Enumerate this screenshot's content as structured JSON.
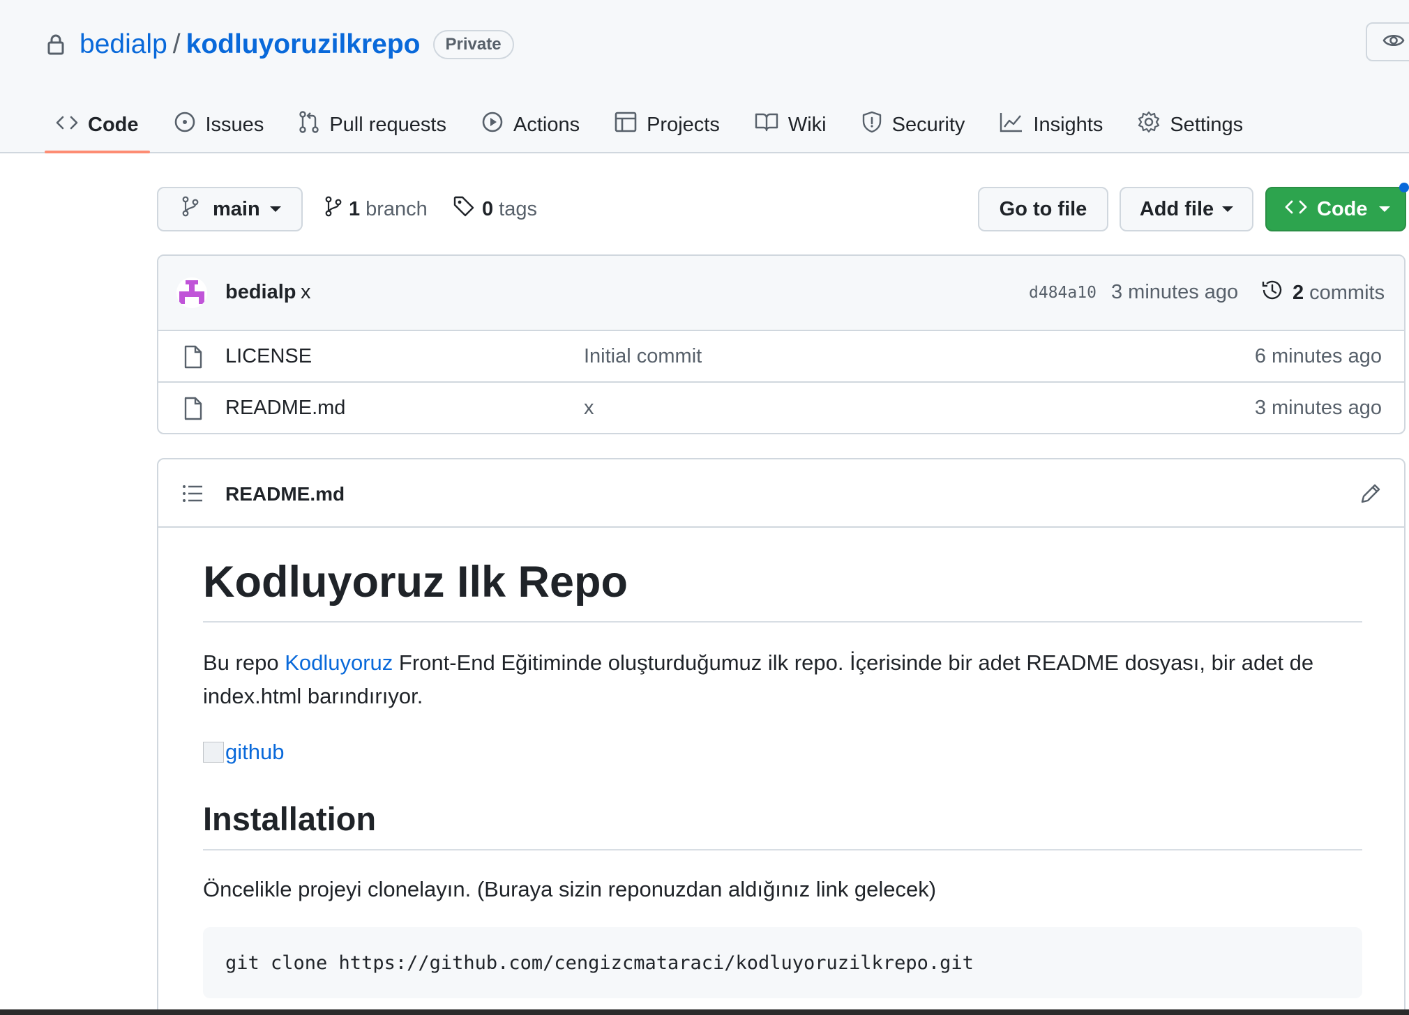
{
  "repo": {
    "owner": "bedialp",
    "separator": "/",
    "name": "kodluyoruzilkrepo",
    "visibility": "Private"
  },
  "tabs": [
    {
      "label": "Code",
      "icon": "code-icon",
      "selected": true
    },
    {
      "label": "Issues",
      "icon": "issue-icon"
    },
    {
      "label": "Pull requests",
      "icon": "pull-request-icon"
    },
    {
      "label": "Actions",
      "icon": "play-icon"
    },
    {
      "label": "Projects",
      "icon": "table-icon"
    },
    {
      "label": "Wiki",
      "icon": "book-icon"
    },
    {
      "label": "Security",
      "icon": "shield-icon"
    },
    {
      "label": "Insights",
      "icon": "graph-icon"
    },
    {
      "label": "Settings",
      "icon": "gear-icon"
    }
  ],
  "toolbar": {
    "branch": "main",
    "branch_count": "1",
    "branch_label": "branch",
    "tag_count": "0",
    "tag_label": "tags",
    "go_to_file": "Go to file",
    "add_file": "Add file",
    "code": "Code"
  },
  "latest_commit": {
    "author": "bedialp",
    "message": "x",
    "sha": "d484a10",
    "time": "3 minutes ago",
    "commit_count": "2",
    "commit_label": "commits"
  },
  "files": [
    {
      "name": "LICENSE",
      "message": "Initial commit",
      "time": "6 minutes ago"
    },
    {
      "name": "README.md",
      "message": "x",
      "time": "3 minutes ago"
    }
  ],
  "readme": {
    "filename": "README.md",
    "heading": "Kodluyoruz Ilk Repo",
    "intro_before": "Bu repo ",
    "intro_link": "Kodluyoruz",
    "intro_after": " Front-End Eğitiminde oluşturduğumuz ilk repo. İçerisinde bir adet README dosyası, bir adet de index.html barındırıyor.",
    "image_alt": "github",
    "section_heading": "Installation",
    "install_text": "Öncelikle projeyi clonelayın. (Buraya sizin reponuzdan aldığınız link gelecek)",
    "clone_command": "git clone https://github.com/cengizcmataraci/kodluyoruzilkrepo.git"
  },
  "colors": {
    "link": "#0969da",
    "primary_button": "#2da44e",
    "tab_underline": "#fd8c73"
  }
}
